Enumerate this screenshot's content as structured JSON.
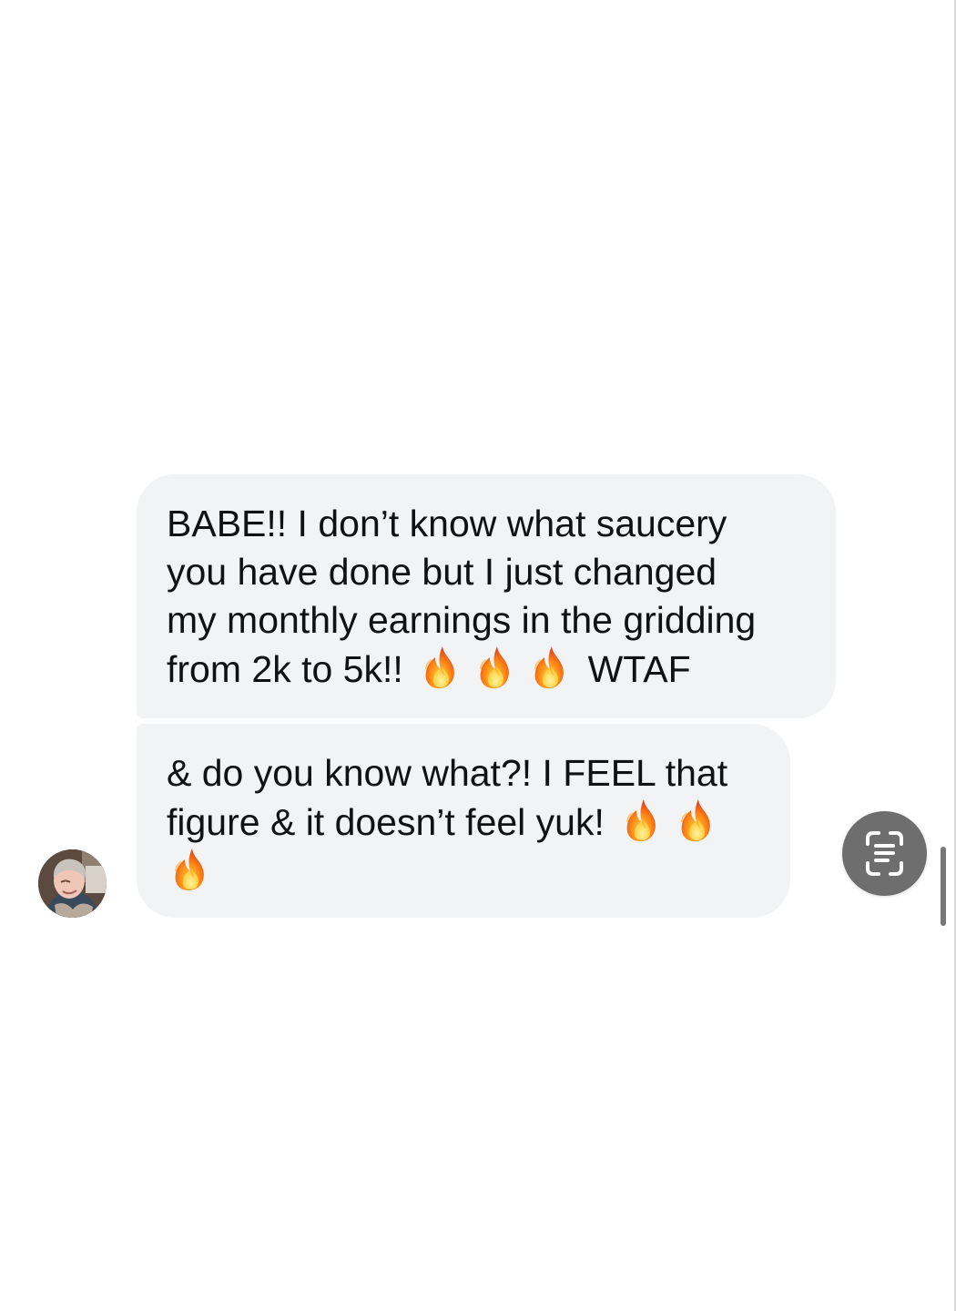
{
  "conversation": {
    "messages": [
      {
        "lines": [
          {
            "text": "BABE!! I don’t know what saucery"
          },
          {
            "text": "you have done but I just changed"
          },
          {
            "text": "my monthly earnings in the gridding"
          },
          {
            "text": "from 2k to 5k!!",
            "emoji_count": 3,
            "tail": "WTAF"
          }
        ]
      },
      {
        "lines": [
          {
            "text": "& do you know what?! I FEEL that"
          },
          {
            "text": "figure & it doesn’t feel yuk!",
            "emoji_count": 2
          },
          {
            "text": "",
            "emoji_count": 1
          }
        ]
      }
    ],
    "emoji": "fire-icon",
    "avatar": "avatar-photo"
  },
  "controls": {
    "scan_icon": "text-scan-icon"
  },
  "colors": {
    "background": "#ffffff",
    "bubble": "#f2f3f5",
    "text": "#111111",
    "scan_button": "#6e6e6e",
    "scrollbar": "#777777"
  }
}
